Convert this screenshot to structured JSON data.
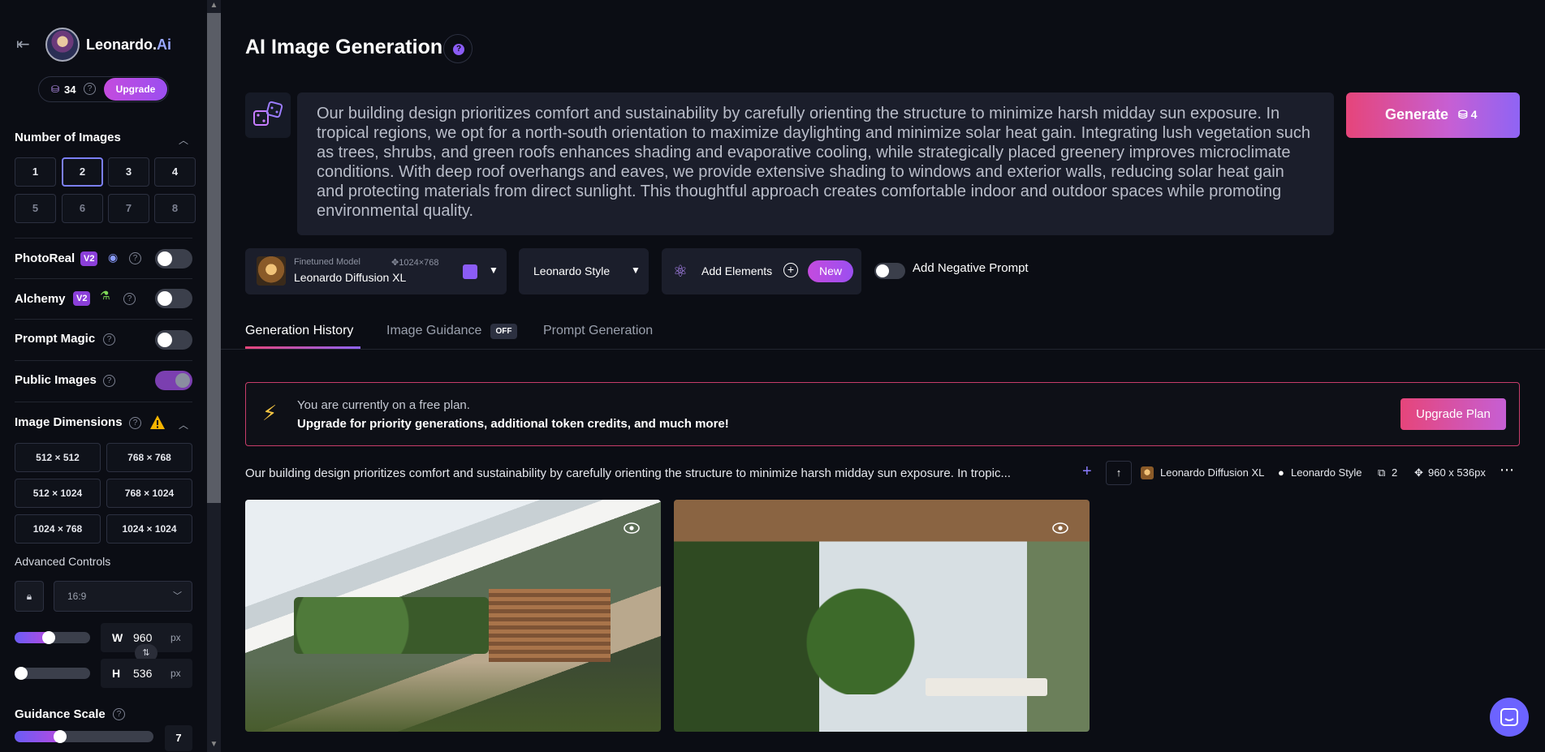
{
  "brand": {
    "name_main": "Leonardo.",
    "name_accent": "Ai"
  },
  "tokens": {
    "count": "34",
    "upgrade_label": "Upgrade"
  },
  "sidebar": {
    "number_of_images": {
      "title": "Number of Images",
      "options": [
        "1",
        "2",
        "3",
        "4",
        "5",
        "6",
        "7",
        "8"
      ],
      "selected": "2"
    },
    "photoreal": {
      "label": "PhotoReal",
      "badge": "V2",
      "on": false
    },
    "alchemy": {
      "label": "Alchemy",
      "badge": "V2",
      "on": false
    },
    "prompt_magic": {
      "label": "Prompt Magic",
      "on": false
    },
    "public_images": {
      "label": "Public Images",
      "on": true
    },
    "image_dimensions": {
      "title": "Image Dimensions",
      "options": [
        "512 × 512",
        "768 × 768",
        "512 × 1024",
        "768 × 1024",
        "1024 × 768",
        "1024 × 1024"
      ]
    },
    "advanced_controls": {
      "label": "Advanced Controls",
      "aspect_ratio": "16:9"
    },
    "width": {
      "label": "W",
      "value": "960",
      "unit": "px",
      "slider_fraction": 0.45
    },
    "height": {
      "label": "H",
      "value": "536",
      "unit": "px",
      "slider_fraction": 0.02
    },
    "guidance_scale": {
      "label": "Guidance Scale",
      "value": "7",
      "slider_fraction": 0.33
    }
  },
  "header": {
    "title": "AI Image Generation",
    "help": "?"
  },
  "prompt": {
    "text": "Our building design prioritizes comfort and sustainability by carefully orienting the structure to minimize harsh midday sun exposure. In tropical regions, we opt for a north-south orientation to maximize daylighting and minimize solar heat gain. Integrating lush vegetation such as trees, shrubs, and green roofs enhances shading and evaporative cooling, while strategically placed greenery improves microclimate conditions. With deep roof overhangs and eaves, we provide extensive shading to windows and exterior walls, reducing solar heat gain and protecting materials from direct sunlight. This thoughtful approach creates comfortable indoor and outdoor spaces while promoting environmental quality."
  },
  "generate": {
    "label": "Generate",
    "cost": "4"
  },
  "model": {
    "caption": "Finetuned Model",
    "resolution": "1024×768",
    "name": "Leonardo Diffusion XL"
  },
  "style": {
    "label": "Leonardo Style"
  },
  "elements": {
    "label": "Add Elements",
    "badge": "New"
  },
  "negative_prompt": {
    "label": "Add Negative Prompt",
    "on": false
  },
  "tabs": [
    {
      "label": "Generation History",
      "active": true
    },
    {
      "label": "Image Guidance",
      "badge": "OFF",
      "active": false
    },
    {
      "label": "Prompt Generation",
      "active": false
    }
  ],
  "banner": {
    "line1": "You are currently on a free plan.",
    "line2": "Upgrade for priority generations, additional token credits, and much more!",
    "button": "Upgrade Plan"
  },
  "generation": {
    "prompt_preview": "Our building design prioritizes comfort and sustainability by carefully orienting the structure to minimize harsh midday sun exposure. In tropic...",
    "model": "Leonardo Diffusion XL",
    "style": "Leonardo Style",
    "count": "2",
    "size": "960 x 536px"
  },
  "colors": {
    "accent": "#8b5cf6",
    "brand_pink": "#e6457a",
    "background": "#0b0d14"
  }
}
